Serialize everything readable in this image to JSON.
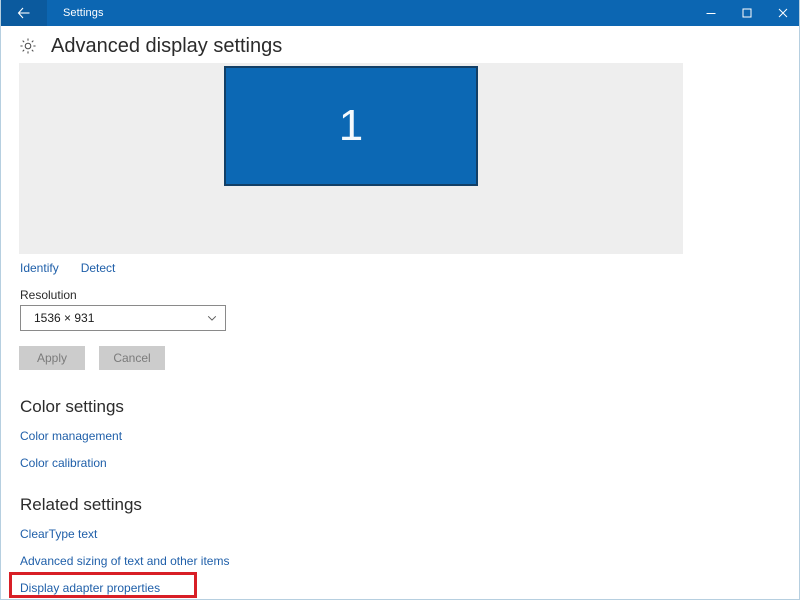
{
  "window": {
    "titlebar": {
      "back_icon": "back-arrow-icon",
      "title": "Settings",
      "minimize_label": "Minimize",
      "maximize_label": "Maximize",
      "close_label": "Close"
    },
    "accent_color": "#0c66b2",
    "back_button_color": "#0b5a9e",
    "border_color": "#b6cfe0"
  },
  "page": {
    "icon": "gear-icon",
    "title": "Advanced display settings"
  },
  "display_preview": {
    "panel_color": "#eeeeee",
    "monitor": {
      "number": "1",
      "fill_color": "#0c68b4",
      "border_color": "#123f66",
      "number_color": "#f4f9fc"
    },
    "actions": [
      {
        "label": "Identify",
        "name": "identify-link"
      },
      {
        "label": "Detect",
        "name": "detect-link"
      }
    ]
  },
  "resolution": {
    "label": "Resolution",
    "value": "1536 × 931",
    "dropdown_icon": "chevron-down-icon"
  },
  "buttons": {
    "apply": "Apply",
    "cancel": "Cancel",
    "disabled_bg": "#cccccc",
    "disabled_text": "#7b7b7b"
  },
  "color_settings": {
    "heading": "Color settings",
    "links": [
      {
        "label": "Color management",
        "name": "color-management-link"
      },
      {
        "label": "Color calibration",
        "name": "color-calibration-link"
      }
    ]
  },
  "related_settings": {
    "heading": "Related settings",
    "links": [
      {
        "label": "ClearType text",
        "name": "cleartype-text-link"
      },
      {
        "label": "Advanced sizing of text and other items",
        "name": "advanced-sizing-link"
      },
      {
        "label": "Display adapter properties",
        "name": "display-adapter-properties-link"
      }
    ]
  },
  "annotation": {
    "highlight_color": "#d81f26",
    "target": "Display adapter properties"
  },
  "link_color": "#1f5fa9"
}
